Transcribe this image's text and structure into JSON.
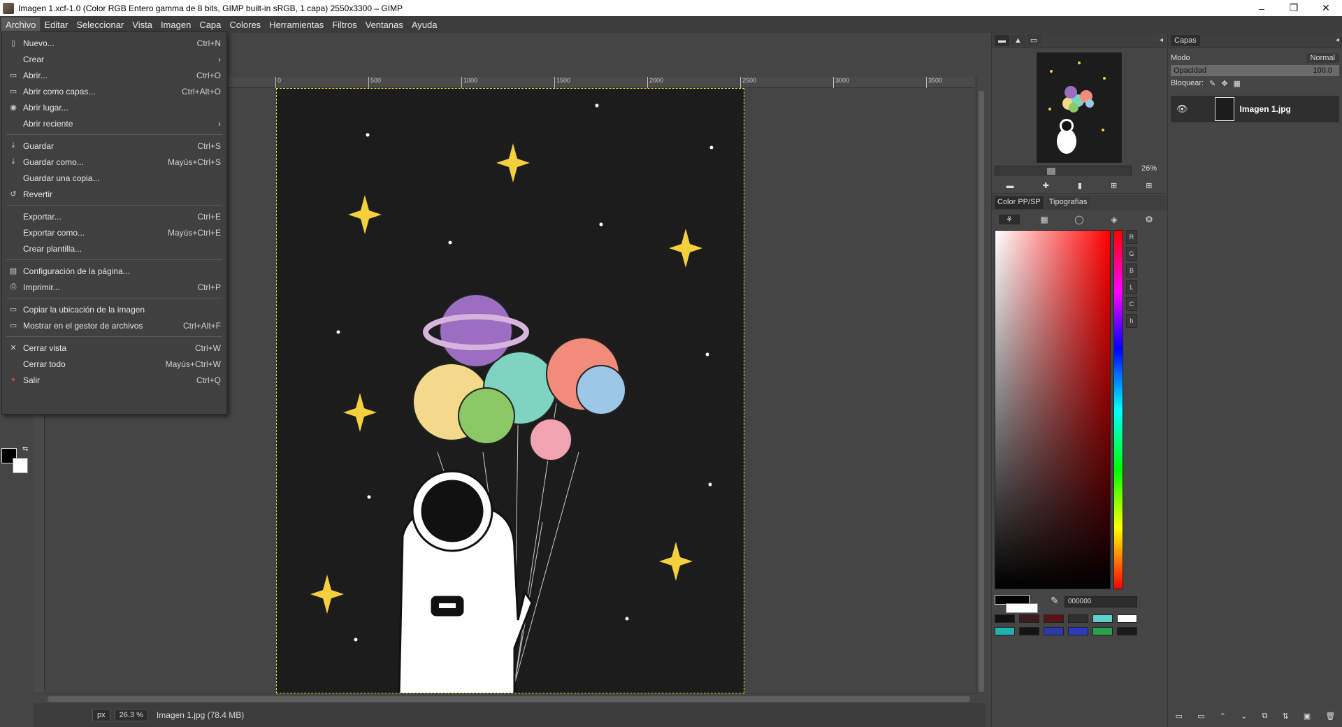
{
  "window": {
    "title": "Imagen 1.xcf-1.0 (Color RGB Entero gamma de 8 bits, GIMP built-in sRGB, 1 capa) 2550x3300 – GIMP",
    "minimize": "–",
    "maximize": "❐",
    "close": "✕"
  },
  "menubar": [
    "Archivo",
    "Editar",
    "Seleccionar",
    "Vista",
    "Imagen",
    "Capa",
    "Colores",
    "Herramientas",
    "Filtros",
    "Ventanas",
    "Ayuda"
  ],
  "file_menu": {
    "g1": [
      {
        "label": "Nuevo...",
        "shortcut": "Ctrl+N",
        "icon": "new-icon"
      },
      {
        "label": "Crear",
        "shortcut": "›",
        "icon": ""
      },
      {
        "label": "Abrir...",
        "shortcut": "Ctrl+O",
        "icon": "open-icon"
      },
      {
        "label": "Abrir como capas...",
        "shortcut": "Ctrl+Alt+O",
        "icon": "open-layers-icon"
      },
      {
        "label": "Abrir lugar...",
        "shortcut": "",
        "icon": "open-location-icon"
      },
      {
        "label": "Abrir reciente",
        "shortcut": "›",
        "icon": ""
      }
    ],
    "g2": [
      {
        "label": "Guardar",
        "shortcut": "Ctrl+S",
        "icon": "save-icon"
      },
      {
        "label": "Guardar como...",
        "shortcut": "Mayús+Ctrl+S",
        "icon": "save-as-icon"
      },
      {
        "label": "Guardar una copia...",
        "shortcut": "",
        "icon": ""
      },
      {
        "label": "Revertir",
        "shortcut": "",
        "icon": "revert-icon"
      }
    ],
    "g3": [
      {
        "label": "Exportar...",
        "shortcut": "Ctrl+E",
        "icon": ""
      },
      {
        "label": "Exportar como...",
        "shortcut": "Mayús+Ctrl+E",
        "icon": ""
      },
      {
        "label": "Crear plantilla...",
        "shortcut": "",
        "icon": ""
      }
    ],
    "g4": [
      {
        "label": "Configuración de la página...",
        "shortcut": "",
        "icon": "page-setup-icon"
      },
      {
        "label": "Imprimir...",
        "shortcut": "Ctrl+P",
        "icon": "print-icon"
      }
    ],
    "g5": [
      {
        "label": "Copiar la ubicación de la imagen",
        "shortcut": "",
        "icon": "copy-location-icon"
      },
      {
        "label": "Mostrar en el gestor de archivos",
        "shortcut": "Ctrl+Alt+F",
        "icon": "file-manager-icon"
      }
    ],
    "g6": [
      {
        "label": "Cerrar vista",
        "shortcut": "Ctrl+W",
        "icon": "close-view-icon"
      },
      {
        "label": "Cerrar todo",
        "shortcut": "Mayús+Ctrl+W",
        "icon": ""
      },
      {
        "label": "Salir",
        "shortcut": "Ctrl+Q",
        "icon": "quit-icon"
      }
    ]
  },
  "ruler_labels": [
    "0",
    "500",
    "1000",
    "1500",
    "2000",
    "2500",
    "3000",
    "3500"
  ],
  "status": {
    "unit": "px",
    "zoom": "26.3 %",
    "file": "Imagen 1.jpg (78.4 MB)"
  },
  "navigator": {
    "zoom": "26%"
  },
  "color_dock": {
    "tab1": "Color PP/SP",
    "tab2": "Tipografías",
    "channels": [
      "R",
      "G",
      "B",
      "L",
      "C",
      "h"
    ],
    "hex": "000000",
    "swatches": [
      "#111111",
      "#3a1a1a",
      "#5a1414",
      "#303030",
      "#5fd1c8",
      "#ffffff",
      "#1fb3b0",
      "#141414",
      "#2a3aa8",
      "#2d3ac0",
      "#28a34a",
      "#1a1a1a"
    ]
  },
  "layers": {
    "tab": "Capas",
    "mode_label": "Modo",
    "mode_value": "Normal",
    "opacity_label": "Opacidad",
    "opacity_value": "100.0",
    "lock_label": "Bloquear:",
    "layer_name": "Imagen 1.jpg"
  },
  "colors": {
    "star": "#f4d03f",
    "sky": "#1c1c1c",
    "selection": "#e6e23b"
  }
}
